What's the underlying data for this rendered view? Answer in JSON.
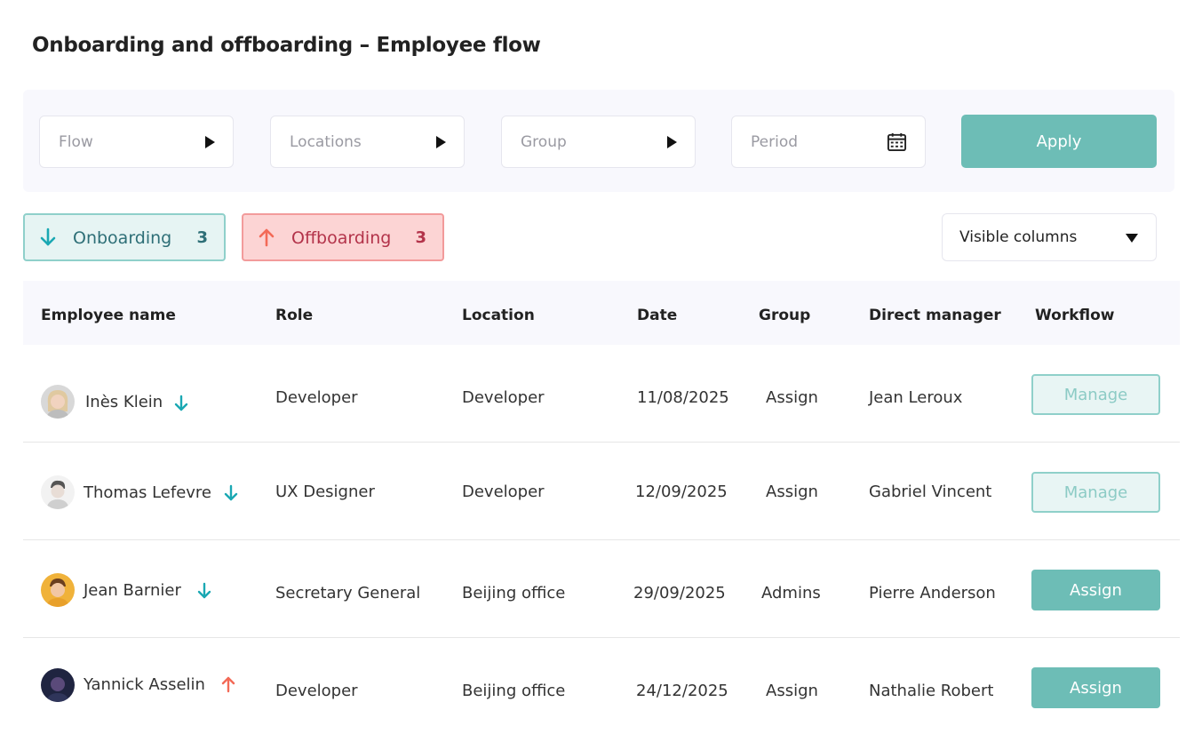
{
  "page": {
    "title": "Onboarding and offboarding – Employee flow"
  },
  "filters": {
    "flow": "Flow",
    "locations": "Locations",
    "group": "Group",
    "period": "Period",
    "apply": "Apply"
  },
  "toggles": {
    "onboarding": {
      "label": "Onboarding",
      "count": "3"
    },
    "offboarding": {
      "label": "Offboarding",
      "count": "3"
    }
  },
  "visible_columns": "Visible columns",
  "table": {
    "headers": [
      "Employee name",
      "Role",
      "Location",
      "Date",
      "Group",
      "Direct manager",
      "Workflow"
    ],
    "rows": [
      {
        "name": "Inès Klein",
        "direction": "onboarding",
        "role": "Developer",
        "location": "Developer",
        "date": "11/08/2025",
        "group": "Assign",
        "manager": "Jean Leroux",
        "action": "Manage"
      },
      {
        "name": "Thomas Lefevre",
        "direction": "onboarding",
        "role": "UX Designer",
        "location": "Developer",
        "date": "12/09/2025",
        "group": "Assign",
        "manager": "Gabriel Vincent",
        "action": "Manage"
      },
      {
        "name": "Jean Barnier",
        "direction": "onboarding",
        "role": "Secretary General",
        "location": "Beijing office",
        "date": "29/09/2025",
        "group": "Admins",
        "manager": "Pierre Anderson",
        "action": "Assign"
      },
      {
        "name": "Yannick Asselin",
        "direction": "offboarding",
        "role": "Developer",
        "location": "Beijing office",
        "date": "24/12/2025",
        "group": "Assign",
        "manager": "Nathalie Robert",
        "action": "Assign"
      }
    ]
  },
  "colors": {
    "accent": "#6dbdb6",
    "onboarding": "#1aa8b3",
    "offboarding": "#f36a57"
  }
}
